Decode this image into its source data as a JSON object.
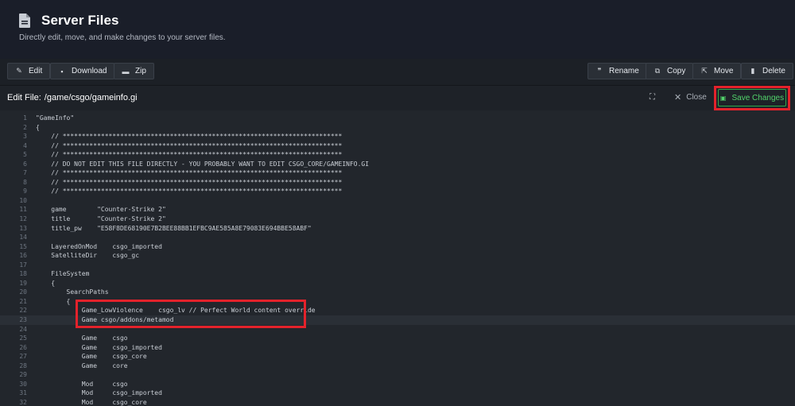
{
  "header": {
    "title": "Server Files",
    "subtitle": "Directly edit, move, and make changes to your server files.",
    "icon": "file-icon"
  },
  "toolbar": {
    "left": [
      {
        "label": "Edit",
        "icon": "pencil-icon"
      },
      {
        "label": "Download",
        "icon": "file-download-icon"
      },
      {
        "label": "Zip",
        "icon": "archive-icon"
      }
    ],
    "right": [
      {
        "label": "Rename",
        "icon": "quote-icon"
      },
      {
        "label": "Copy",
        "icon": "copy-icon"
      },
      {
        "label": "Move",
        "icon": "move-icon"
      },
      {
        "label": "Delete",
        "icon": "trash-icon"
      }
    ]
  },
  "editor": {
    "label": "Edit File:",
    "path": "/game/csgo/gameinfo.gi",
    "close_label": "Close",
    "save_label": "Save Changes",
    "accent_color": "#52d36b",
    "highlight_color": "#e3222b",
    "active_line": 23,
    "lines": [
      {
        "n": "1",
        "t": "\"GameInfo\""
      },
      {
        "n": "2",
        "t": "{"
      },
      {
        "n": "3",
        "t": "    // *************************************************************************"
      },
      {
        "n": "4",
        "t": "    // *************************************************************************"
      },
      {
        "n": "5",
        "t": "    // *************************************************************************"
      },
      {
        "n": "6",
        "t": "    // DO NOT EDIT THIS FILE DIRECTLY - YOU PROBABLY WANT TO EDIT CSGO_CORE/GAMEINFO.GI"
      },
      {
        "n": "7",
        "t": "    // *************************************************************************"
      },
      {
        "n": "8",
        "t": "    // *************************************************************************"
      },
      {
        "n": "9",
        "t": "    // *************************************************************************"
      },
      {
        "n": "10",
        "t": ""
      },
      {
        "n": "11",
        "t": "    game        \"Counter-Strike 2\""
      },
      {
        "n": "12",
        "t": "    title       \"Counter-Strike 2\""
      },
      {
        "n": "13",
        "t": "    title_pw    \"E58F8DE68190E7B2BEE88BB1EFBC9AE585A8E79083E694BBE58ABF\""
      },
      {
        "n": "14",
        "t": ""
      },
      {
        "n": "15",
        "t": "    LayeredOnMod    csgo_imported"
      },
      {
        "n": "16",
        "t": "    SatelliteDir    csgo_gc"
      },
      {
        "n": "17",
        "t": ""
      },
      {
        "n": "18",
        "t": "    FileSystem"
      },
      {
        "n": "19",
        "t": "    {"
      },
      {
        "n": "20",
        "t": "        SearchPaths"
      },
      {
        "n": "21",
        "t": "        {"
      },
      {
        "n": "22",
        "t": "            Game_LowViolence    csgo_lv // Perfect World content override"
      },
      {
        "n": "23",
        "t": "            Game csgo/addons/metamod"
      },
      {
        "n": "24",
        "t": ""
      },
      {
        "n": "25",
        "t": "            Game    csgo"
      },
      {
        "n": "26",
        "t": "            Game    csgo_imported"
      },
      {
        "n": "27",
        "t": "            Game    csgo_core"
      },
      {
        "n": "28",
        "t": "            Game    core"
      },
      {
        "n": "29",
        "t": ""
      },
      {
        "n": "30",
        "t": "            Mod     csgo"
      },
      {
        "n": "31",
        "t": "            Mod     csgo_imported"
      },
      {
        "n": "32",
        "t": "            Mod     csgo_core"
      }
    ]
  }
}
